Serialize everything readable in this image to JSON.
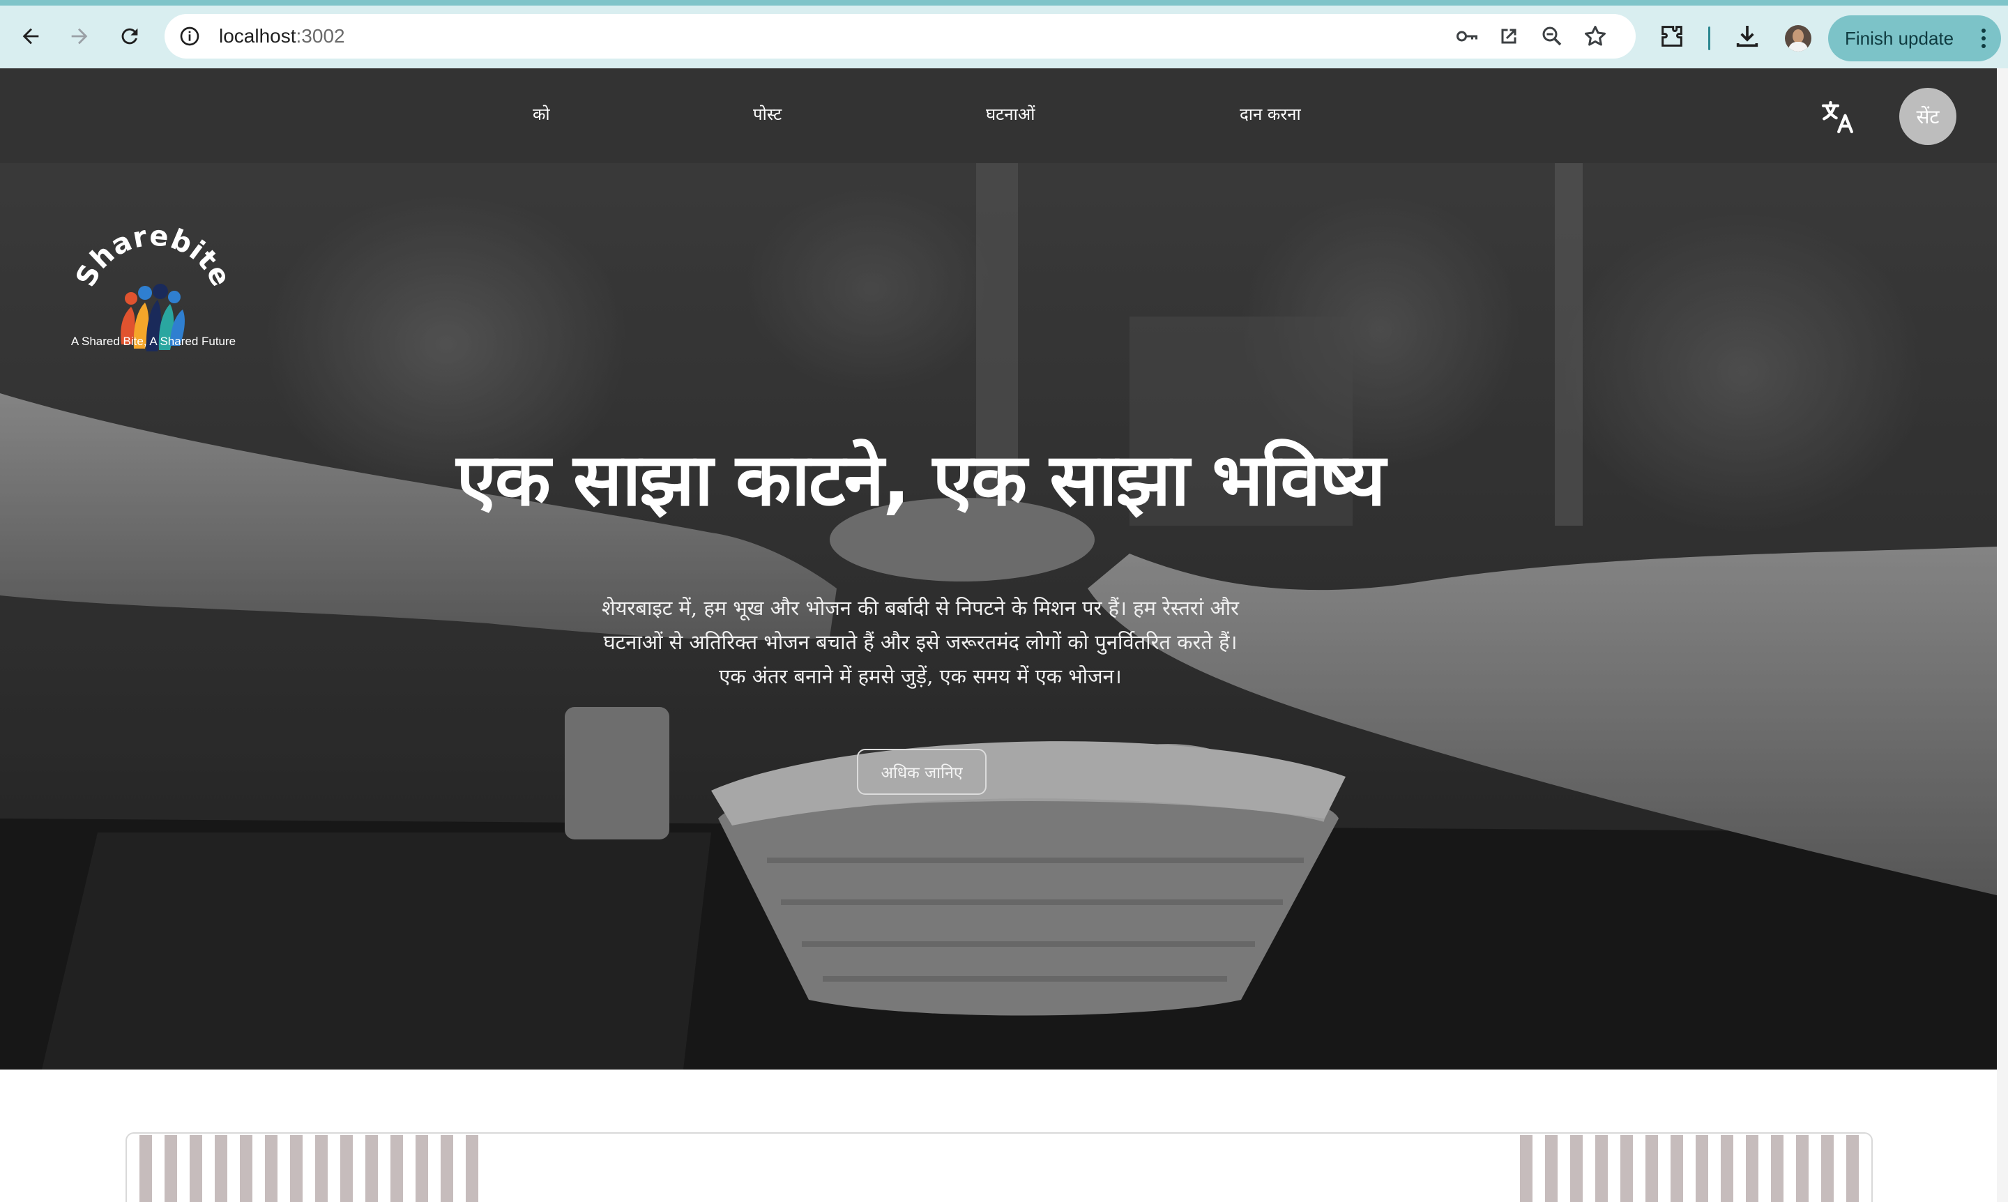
{
  "browser": {
    "url_host": "localhost",
    "url_port": ":3002",
    "finish_update_label": "Finish update"
  },
  "nav": {
    "items": [
      {
        "label": "को"
      },
      {
        "label": "पोस्ट"
      },
      {
        "label": "घटनाओं"
      },
      {
        "label": "दान करना"
      }
    ],
    "avatar_initials": "सेंट"
  },
  "brand": {
    "name": "Sharebite",
    "tagline": "A Shared Bite, A Shared Future",
    "colors": [
      "#2f7fd0",
      "#e0532f",
      "#f4a62a",
      "#1a2a5a",
      "#2aa6a0"
    ]
  },
  "hero": {
    "title": "एक साझा काटने, एक साझा भविष्य",
    "paragraph_lines": [
      "शेयरबाइट में, हम भूख और भोजन की बर्बादी से निपटने के मिशन पर हैं। हम रेस्तरां और",
      "घटनाओं से अतिरिक्त भोजन बचाते हैं और इसे जरूरतमंद लोगों को पुनर्वितरित करते हैं।",
      "एक अंतर बनाने में हमसे जुड़ें, एक समय में एक भोजन।"
    ],
    "button_label": "अधिक जानिए"
  }
}
